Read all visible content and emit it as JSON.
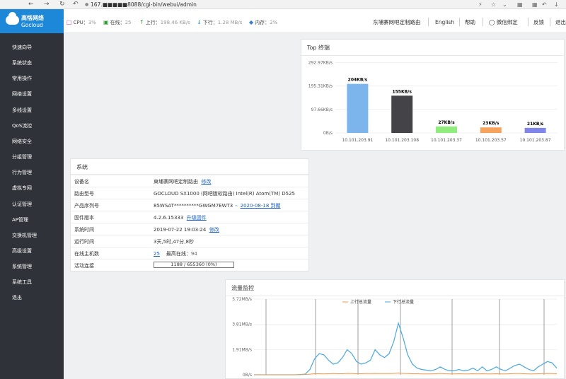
{
  "browser": {
    "url": "167.■■■■■8088/cgi-bin/webui/admin"
  },
  "header": {
    "logo_cn": "高恪网络",
    "logo_en": "Gocloud",
    "cpu_label": "CPU：",
    "cpu_val": "3%",
    "online_label": "在线：",
    "online_val": "25",
    "up_label": "上行：",
    "up_val": "198.46 KB/s",
    "down_label": "下行：",
    "down_val": "1.28 MB/s",
    "mem_label": "内存：",
    "mem_val": "2%",
    "router_name": "东埔寨网吧定制路由",
    "english": "English",
    "help": "帮助",
    "wechat": "微信绑定",
    "feedback": "反馈",
    "logout": "退出"
  },
  "sidebar": {
    "items": [
      "快速向导",
      "系统状态",
      "常用操作",
      "网络设置",
      "多线设置",
      "QoS流控",
      "网络安全",
      "分组管理",
      "行为管理",
      "虚拟专网",
      "认证管理",
      "AP管理",
      "交换机管理",
      "高级设置",
      "系统管理",
      "系统工具",
      "退出"
    ]
  },
  "top": {
    "title": "Top 终端"
  },
  "system": {
    "title": "系统",
    "rows": [
      {
        "k": "设备名",
        "v": "東埔寨网吧定制路由",
        "link": "修改"
      },
      {
        "k": "路由型号",
        "v": "GOCLOUD SX1000 (网吧版软路由) Intel(R) Atom(TM) D525"
      },
      {
        "k": "产品序列号",
        "v": "85WSAT**********GWGM7EWT3",
        "link": "2020-08-18 到期"
      },
      {
        "k": "固件版本",
        "v": "4.2.6.15333",
        "link": "升级固件"
      },
      {
        "k": "系统时间",
        "v": "2019-07-22 19:03:24",
        "link": "修改"
      },
      {
        "k": "运行时间",
        "v": "3天,5时,47分,8秒"
      },
      {
        "k": "在线主机数",
        "v": "25",
        "extra_label": "最高在线：",
        "extra_val": "94"
      },
      {
        "k": "活动连接",
        "v": "1188 / 655360 (0%)",
        "progress": 0.0018
      }
    ]
  },
  "traffic": {
    "title": "流量监控"
  },
  "chart_data": [
    {
      "type": "bar",
      "title": "Top 终端",
      "categories": [
        "10.101.203.91",
        "10.101.203.108",
        "10.101.203.37",
        "10.101.203.57",
        "10.101.203.87"
      ],
      "values": [
        204,
        155,
        27,
        23,
        21
      ],
      "data_labels": [
        "204KB/s",
        "155KB/s",
        "27KB/s",
        "23KB/s",
        "21KB/s"
      ],
      "colors": [
        "#7cb5ec",
        "#434348",
        "#90ed7d",
        "#f7a35c",
        "#8085e9"
      ],
      "y_ticks": [
        "0B/s",
        "97.66KB/s",
        "195.31KB/s",
        "292.97KB/s"
      ],
      "ylim": [
        0,
        300
      ]
    },
    {
      "type": "line",
      "title": "流量监控",
      "series": [
        {
          "name": "上行总流量",
          "color": "#f0a050"
        },
        {
          "name": "下行总流量",
          "color": "#4aa8de"
        }
      ],
      "y_ticks": [
        "0B/s",
        "1.91MB/s",
        "3.81MB/s",
        "5.72MB/s"
      ],
      "ylim": [
        0,
        5.72
      ],
      "down": [
        0,
        0,
        0,
        0,
        0,
        0,
        0,
        0,
        0,
        0,
        0.02,
        0.05,
        0.4,
        1.2,
        1.6,
        1.5,
        1.1,
        0.8,
        0.9,
        1.3,
        1.9,
        1.6,
        1.0,
        0.8,
        0.9,
        1.1,
        1.9,
        1.5,
        1.3,
        1.6,
        2.5,
        3.9,
        2.8,
        1.5,
        0.8,
        0.5,
        0.4,
        0.35,
        0.3,
        0.4,
        0.6,
        0.4,
        0.3,
        0.3,
        0.4,
        0.3,
        0.35,
        0.5,
        0.3,
        0.6,
        0.3,
        0.4,
        0.6,
        0.4,
        0.3,
        0.5,
        0.7,
        0.8,
        0.6,
        0.4,
        0.3,
        0.6,
        0.8,
        1.0,
        0.9,
        0.5
      ],
      "up": [
        0,
        0,
        0,
        0,
        0,
        0,
        0,
        0,
        0,
        0,
        0.01,
        0.02,
        0.05,
        0.08,
        0.08,
        0.07,
        0.08,
        0.09,
        0.08,
        0.08,
        0.1,
        0.09,
        0.08,
        0.08,
        0.09,
        0.09,
        0.1,
        0.09,
        0.09,
        0.09,
        0.1,
        0.12,
        0.1,
        0.09,
        0.08,
        0.08,
        0.07,
        0.07,
        0.07,
        0.08,
        0.1,
        0.08,
        0.07,
        0.07,
        0.08,
        0.07,
        0.07,
        0.08,
        0.07,
        0.08,
        0.07,
        0.07,
        0.08,
        0.07,
        0.07,
        0.08,
        0.09,
        0.09,
        0.08,
        0.07,
        0.07,
        0.08,
        0.09,
        0.1,
        0.09,
        0.08
      ]
    }
  ]
}
